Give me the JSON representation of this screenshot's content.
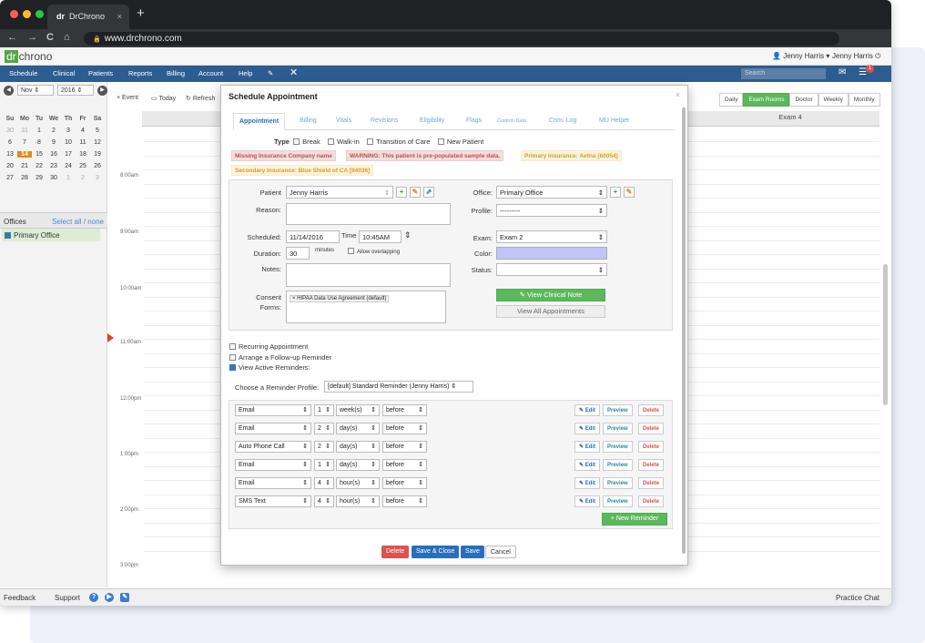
{
  "browser": {
    "tab_icon": "dr",
    "tab_title": "DrChrono",
    "tab_close": "×",
    "new_tab": "+",
    "url": "www.drchrono.com",
    "lock": "🔒",
    "back": "←",
    "forward": "→",
    "reload": "C",
    "home": "⌂"
  },
  "app": {
    "logo_dr": "dr",
    "logo_text": "chrono",
    "user1": "Jenny Harris",
    "user2": "Jenny Harris"
  },
  "menu": [
    "Schedule",
    "Clinical",
    "Patients",
    "Reports",
    "Billing",
    "Account",
    "Help"
  ],
  "search_placeholder": "Search",
  "notif_count": "1",
  "left": {
    "month": "Nov",
    "year": "2016",
    "days_hdr": [
      "Su",
      "Mo",
      "Tu",
      "We",
      "Th",
      "Fr",
      "Sa"
    ],
    "weeks": [
      [
        "30",
        "31",
        "1",
        "2",
        "3",
        "4",
        "5"
      ],
      [
        "6",
        "7",
        "8",
        "9",
        "10",
        "11",
        "12"
      ],
      [
        "13",
        "14",
        "15",
        "16",
        "17",
        "18",
        "19"
      ],
      [
        "20",
        "21",
        "22",
        "23",
        "24",
        "25",
        "26"
      ],
      [
        "27",
        "28",
        "29",
        "30",
        "1",
        "2",
        "3"
      ]
    ],
    "offices_label": "Offices",
    "select_all": "Select all / none",
    "office": "Primary Office"
  },
  "toolbar": {
    "event": "+ Event",
    "today": "Today",
    "refresh": "Refresh"
  },
  "views": [
    "Daily",
    "Exam Rooms",
    "Doctor",
    "Weekly",
    "Monthly"
  ],
  "grid": {
    "exam4": "Exam 4",
    "times": [
      "8:00am",
      "9:00am",
      "10:00am",
      "11:00am",
      "12:00pm",
      "1:00pm",
      "2:00pm",
      "3:00pm"
    ]
  },
  "footer": {
    "feedback": "Feedback",
    "support": "Support",
    "chat": "Practice Chat"
  },
  "modal": {
    "title": "Schedule Appointment",
    "close": "×",
    "tabs": [
      "Appointment",
      "Billing",
      "Vitals",
      "Revisions",
      "Eligibility",
      "Flags",
      "Custom Data",
      "Com. Log",
      "MU Helper"
    ],
    "type_label": "Type",
    "types": [
      "Break",
      "Walk-in",
      "Transition of Care",
      "New Patient"
    ],
    "alert1": "Missing Insurance Company name",
    "alert2": "WARNING: This patient is pre-populated sample data.",
    "alert3": "Primary Insurance: Aetna [60054]",
    "alert4": "Secondary Insurance: Blue Shield of CA [94036]",
    "patient_label": "Patient",
    "patient": "Jenny Harris",
    "reason_label": "Reason:",
    "scheduled_label": "Scheduled:",
    "date": "11/14/2016",
    "time_label": "Time",
    "time": "10:45AM",
    "duration_label": "Duration:",
    "duration": "30",
    "minutes": "minutes",
    "allow_overlap": "Allow overlapping",
    "notes_label": "Notes:",
    "consent_label": "Consent Forms:",
    "consent_item": "× HIPAA Data Use Agreement (default)",
    "office_label": "Office:",
    "office": "Primary Office",
    "profile_label": "Profile:",
    "profile": "---------",
    "exam_label": "Exam:",
    "exam": "Exam 2",
    "color_label": "Color:",
    "color_value": "#c0c4f6",
    "status_label": "Status:",
    "clinical_note": "View Clinical Note",
    "all_appts": "View All Appointments",
    "recurring": "Recurring Appointment",
    "followup": "Arrange a Follow-up Reminder",
    "view_reminders": "View Active Reminders:",
    "reminder_profile_label": "Choose a Reminder Profile:",
    "reminder_profile": "[default] Standard Reminder (Jenny Harris)",
    "reminders": [
      {
        "method": "Email",
        "num": "1",
        "unit": "week(s)",
        "when": "before"
      },
      {
        "method": "Email",
        "num": "2",
        "unit": "day(s)",
        "when": "before"
      },
      {
        "method": "Auto Phone Call",
        "num": "2",
        "unit": "day(s)",
        "when": "before"
      },
      {
        "method": "Email",
        "num": "1",
        "unit": "day(s)",
        "when": "before"
      },
      {
        "method": "Email",
        "num": "4",
        "unit": "hour(s)",
        "when": "before"
      },
      {
        "method": "SMS Text",
        "num": "4",
        "unit": "hour(s)",
        "when": "before"
      }
    ],
    "edit": "Edit",
    "preview": "Preview",
    "delete": "Delete",
    "new_reminder": "+ New Reminder",
    "btn_delete": "Delete",
    "btn_save_close": "Save & Close",
    "btn_save": "Save",
    "btn_cancel": "Cancel"
  }
}
